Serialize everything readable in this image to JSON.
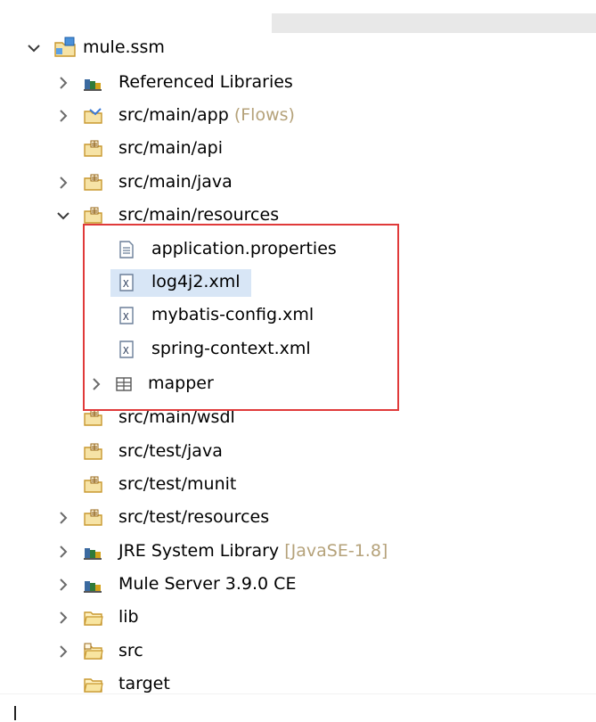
{
  "tree": {
    "project": "mule.ssm",
    "rows": [
      {
        "label": "Referenced Libraries"
      },
      {
        "label": "src/main/app",
        "decoration": "(Flows)"
      },
      {
        "label": "src/main/api"
      },
      {
        "label": "src/main/java"
      },
      {
        "label": "src/main/resources"
      },
      {
        "label": "application.properties"
      },
      {
        "label": "log4j2.xml"
      },
      {
        "label": "mybatis-config.xml"
      },
      {
        "label": "spring-context.xml"
      },
      {
        "label": "mapper"
      },
      {
        "label": "src/main/wsdl"
      },
      {
        "label": "src/test/java"
      },
      {
        "label": "src/test/munit"
      },
      {
        "label": "src/test/resources"
      },
      {
        "label": "JRE System Library",
        "decoration": "[JavaSE-1.8]"
      },
      {
        "label": "Mule Server 3.9.0 CE"
      },
      {
        "label": "lib"
      },
      {
        "label": "src"
      },
      {
        "label": "target"
      }
    ]
  },
  "colors": {
    "selection": "#d8e6f6",
    "highlight_box": "#e03a3a",
    "decoration": "#b5a27a"
  }
}
